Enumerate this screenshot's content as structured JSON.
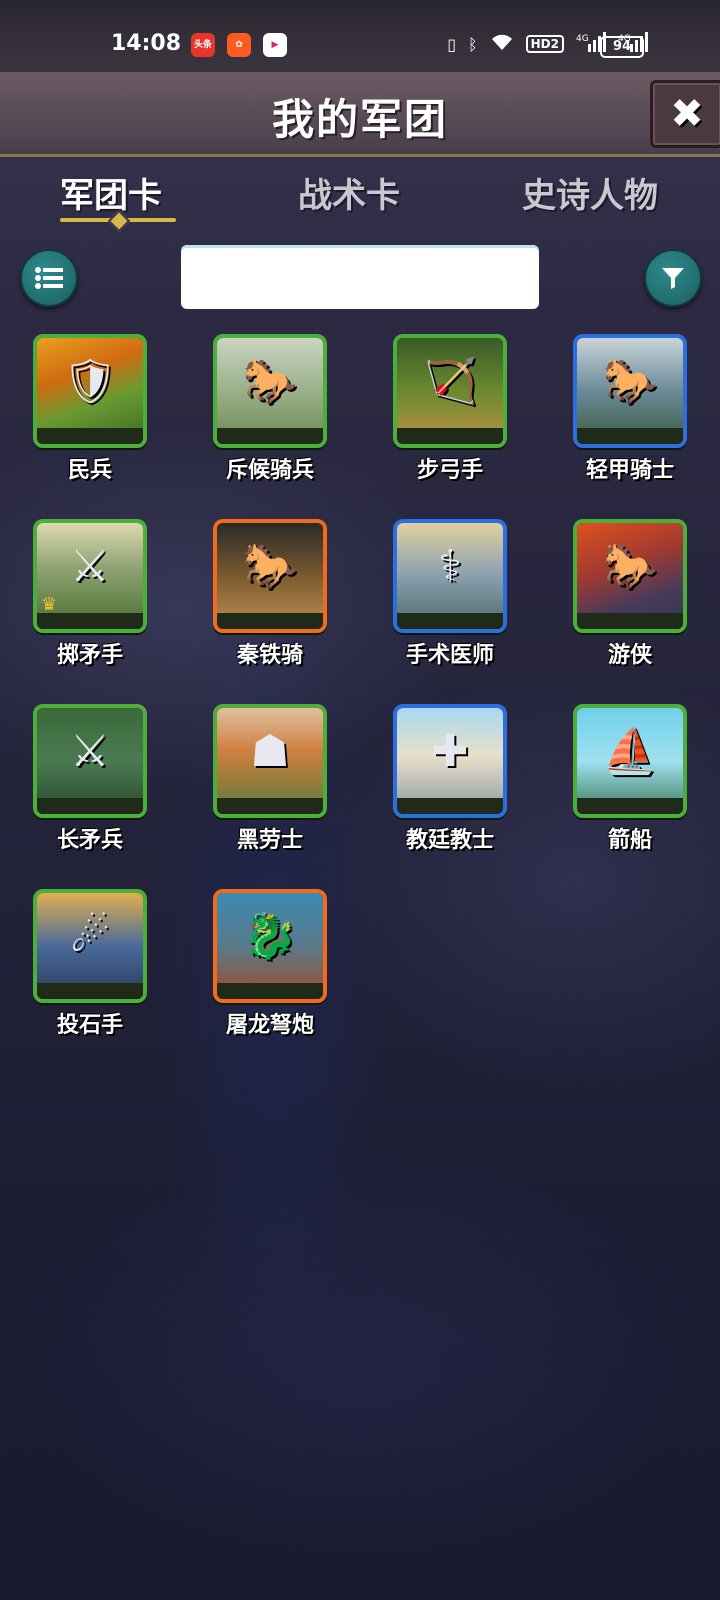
{
  "status_bar": {
    "time": "14:08",
    "battery": "94",
    "hd_label": "HD2",
    "network_labels": [
      "4G",
      "4G"
    ]
  },
  "header": {
    "title": "我的军团"
  },
  "tabs": [
    {
      "label": "军团卡",
      "active": true
    },
    {
      "label": "战术卡",
      "active": false
    },
    {
      "label": "史诗人物",
      "active": false
    }
  ],
  "search": {
    "value": "",
    "placeholder": ""
  },
  "cards": [
    {
      "name": "民兵",
      "rarity": "common",
      "art": "militia"
    },
    {
      "name": "斥候骑兵",
      "rarity": "common",
      "art": "scout-cavalry"
    },
    {
      "name": "步弓手",
      "rarity": "common",
      "art": "archer"
    },
    {
      "name": "轻甲骑士",
      "rarity": "rare",
      "art": "light-knight"
    },
    {
      "name": "掷矛手",
      "rarity": "common",
      "art": "javelin"
    },
    {
      "name": "秦铁骑",
      "rarity": "epic",
      "art": "qin-cavalry"
    },
    {
      "name": "手术医师",
      "rarity": "rare",
      "art": "surgeon"
    },
    {
      "name": "游侠",
      "rarity": "common",
      "art": "ranger"
    },
    {
      "name": "长矛兵",
      "rarity": "common",
      "art": "spearman"
    },
    {
      "name": "黑劳士",
      "rarity": "common",
      "art": "helot"
    },
    {
      "name": "教廷教士",
      "rarity": "rare",
      "art": "priest"
    },
    {
      "name": "箭船",
      "rarity": "common",
      "art": "arrow-ship"
    },
    {
      "name": "投石手",
      "rarity": "common",
      "art": "slinger"
    },
    {
      "name": "屠龙弩炮",
      "rarity": "epic",
      "art": "dragon-ballista"
    }
  ],
  "colors": {
    "common_border": "#4caf3a",
    "rare_border": "#2e6fe0",
    "epic_border": "#f06b1c",
    "accent_gold": "#d9b84a",
    "teal_button": "#1b5e62"
  }
}
